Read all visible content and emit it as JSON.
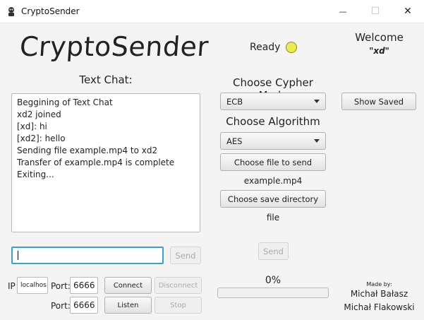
{
  "window": {
    "title": "CryptoSender",
    "minimize_glyph": "—",
    "maximize_glyph": "☐",
    "close_glyph": "✕"
  },
  "header": {
    "logo": "CryptoSender",
    "status": "Ready",
    "status_light_color": "#ecec4e",
    "welcome": "Welcome",
    "username": "\"xd\""
  },
  "chat": {
    "title": "Text Chat:",
    "lines": [
      "Beggining of Text Chat",
      "xd2 joined",
      "[xd]: hi",
      "[xd2]: hello",
      "Sending file example.mp4 to xd2",
      "Transfer of example.mp4 is complete",
      "Exiting..."
    ],
    "input_value": "",
    "send_label": "Send"
  },
  "crypto": {
    "cypher_label": "Choose Cypher Mode",
    "cypher_selected": "ECB",
    "algorithm_label": "Choose Algorithm",
    "algorithm_selected": "AES",
    "choose_file_label": "Choose file to send",
    "file_name": "example.mp4",
    "choose_dir_label": "Choose save directory",
    "dir_name": "file",
    "send_label": "Send",
    "progress_text": "0%",
    "progress_value": 0
  },
  "side": {
    "show_saved_label": "Show Saved"
  },
  "network": {
    "ip_label": "IP",
    "ip_value": "localhos",
    "port_label": "Port:",
    "connect_port": "6666",
    "listen_port": "6666",
    "connect_label": "Connect",
    "disconnect_label": "Disconnect",
    "listen_label": "Listen",
    "stop_label": "Stop"
  },
  "credits": {
    "made_by": "Made by:",
    "authors": [
      "Michał Bałasz",
      "Michał Flakowski"
    ]
  }
}
